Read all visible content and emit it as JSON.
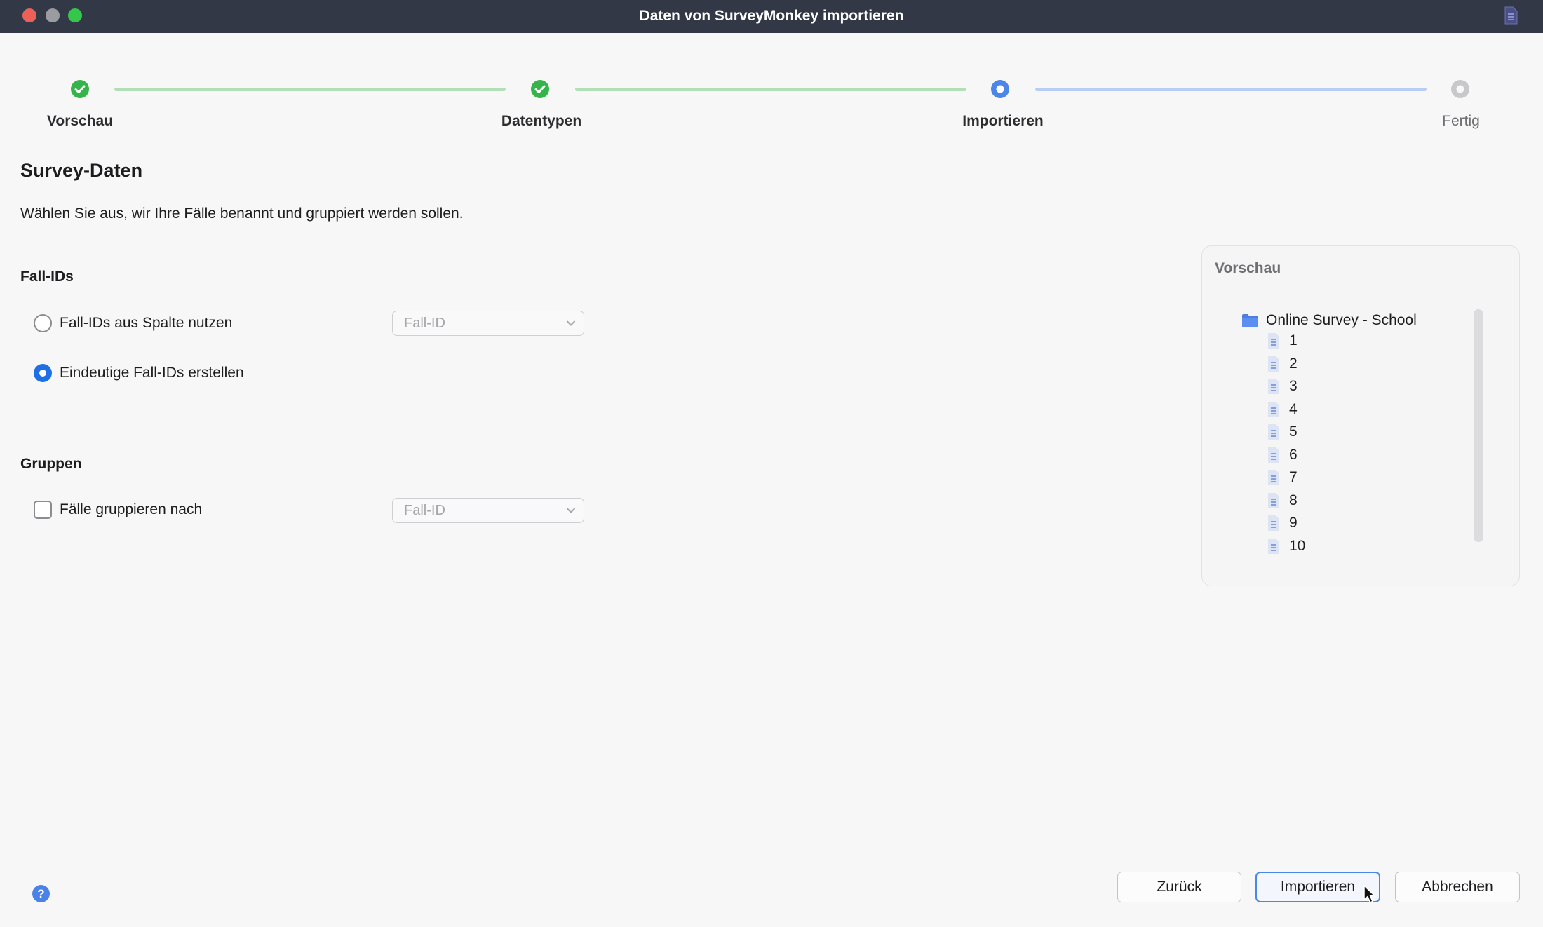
{
  "window": {
    "title": "Daten von SurveyMonkey importieren",
    "title_icon": "document-list-icon"
  },
  "steps": [
    {
      "label": "Vorschau",
      "state": "done"
    },
    {
      "label": "Datentypen",
      "state": "done"
    },
    {
      "label": "Importieren",
      "state": "current"
    },
    {
      "label": "Fertig",
      "state": "pending"
    }
  ],
  "main": {
    "heading": "Survey-Daten",
    "description": "Wählen Sie aus, wir Ihre Fälle benannt und gruppiert werden sollen."
  },
  "case_ids": {
    "title": "Fall-IDs",
    "option_column": {
      "label": "Fall-IDs aus Spalte nutzen",
      "selected": false
    },
    "column_select": {
      "value": "Fall-ID",
      "enabled": false
    },
    "option_unique": {
      "label": "Eindeutige Fall-IDs erstellen",
      "selected": true
    }
  },
  "groups": {
    "title": "Gruppen",
    "option_group_by": {
      "label": "Fälle gruppieren nach",
      "checked": false
    },
    "group_select": {
      "value": "Fall-ID",
      "enabled": false
    }
  },
  "preview": {
    "title": "Vorschau",
    "root": {
      "label": "Online Survey - School",
      "icon": "folder-icon"
    },
    "items": [
      "1",
      "2",
      "3",
      "4",
      "5",
      "6",
      "7",
      "8",
      "9",
      "10"
    ]
  },
  "footer": {
    "help_label": "?",
    "back_label": "Zurück",
    "import_label": "Importieren",
    "cancel_label": "Abbrechen"
  },
  "colors": {
    "titlebar": "#333846",
    "step_done": "#34b44a",
    "step_current": "#4c86e6",
    "step_pending": "#c8c8cc",
    "accent": "#1f6fe5"
  }
}
